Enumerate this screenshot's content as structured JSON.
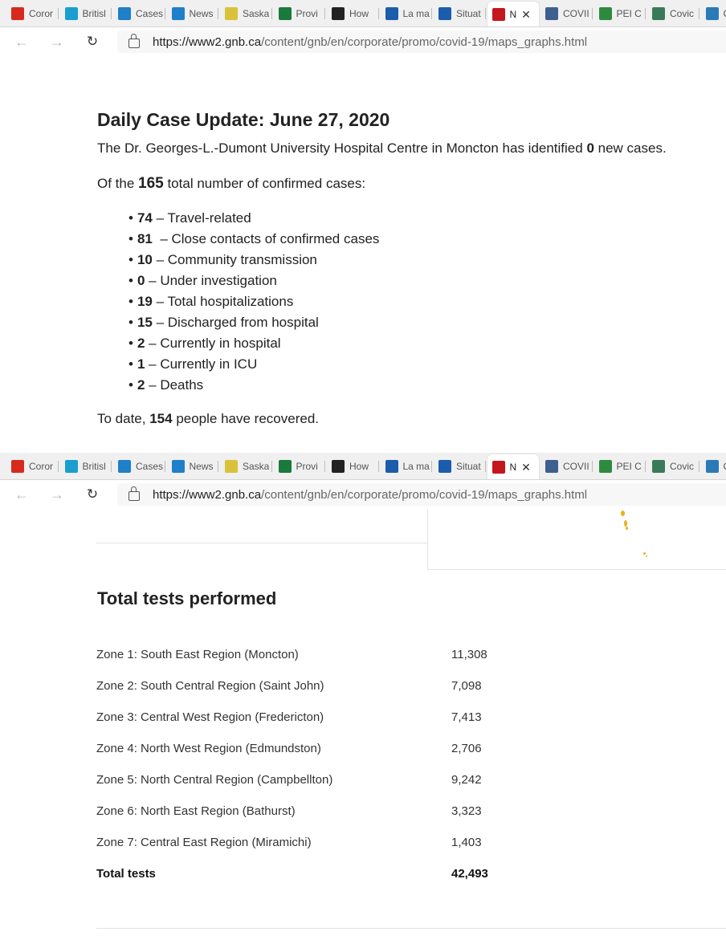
{
  "browser": {
    "tabs": [
      {
        "label": "Coror",
        "icon": "maple-leaf-icon",
        "color": "#d52b1e"
      },
      {
        "label": "Britisl",
        "icon": "bc-icon",
        "color": "#1a9ecf"
      },
      {
        "label": "Cases",
        "icon": "chart-icon",
        "color": "#1f7fc8"
      },
      {
        "label": "News",
        "icon": "chart-icon",
        "color": "#1f7fc8"
      },
      {
        "label": "Saska",
        "icon": "wheat-icon",
        "color": "#d9c23a"
      },
      {
        "label": "Provi",
        "icon": "manitoba-icon",
        "color": "#1a7a3c"
      },
      {
        "label": "How",
        "icon": "ontario-icon",
        "color": "#222222"
      },
      {
        "label": "La ma",
        "icon": "fleur-de-lis-icon",
        "color": "#1b5dab"
      },
      {
        "label": "Situat",
        "icon": "fleur-de-lis-icon",
        "color": "#1b5dab"
      },
      {
        "label": "N",
        "icon": "nb-icon",
        "color": "#c4161c",
        "active": true
      },
      {
        "label": "COVII",
        "icon": "ns-icon",
        "color": "#3f5f8f"
      },
      {
        "label": "PEI C",
        "icon": "pei-icon",
        "color": "#2e8b3e"
      },
      {
        "label": "Covic",
        "icon": "globe-icon",
        "color": "#3a7a5a"
      },
      {
        "label": "C",
        "icon": "nl-icon",
        "color": "#2a7ab8"
      }
    ],
    "url_host": "https://www2.gnb.ca",
    "url_path": "/content/gnb/en/corporate/promo/covid-19/maps_graphs.html"
  },
  "update": {
    "title": "Daily Case Update: June 27, 2020",
    "hospital_pre": "The Dr. Georges-L.-Dumont University Hospital Centre in Moncton has identified ",
    "hospital_num": "0",
    "hospital_post": " new cases.",
    "total_pre": "Of the ",
    "total_num": "165",
    "total_post": " total number of confirmed cases:",
    "items": [
      {
        "num": "74",
        "text": " – Travel-related"
      },
      {
        "num": "81",
        "text": "  – Close contacts of confirmed cases"
      },
      {
        "num": "10",
        "text": " – Community transmission"
      },
      {
        "num": "0",
        "text": " – Under investigation"
      },
      {
        "num": "19",
        "text": " – Total hospitalizations"
      },
      {
        "num": "15",
        "text": " – Discharged from hospital"
      },
      {
        "num": "2",
        "text": " – Currently in hospital"
      },
      {
        "num": "1",
        "text": " – Currently in ICU"
      },
      {
        "num": "2",
        "text": " – Deaths"
      }
    ],
    "recovered_pre": "To date, ",
    "recovered_num": "154",
    "recovered_post": " people have recovered."
  },
  "tests": {
    "title": "Total tests performed",
    "rows": [
      {
        "zone": "Zone 1: South East Region (Moncton)",
        "value": "11,308"
      },
      {
        "zone": "Zone 2: South Central Region (Saint John)",
        "value": "7,098"
      },
      {
        "zone": "Zone 3: Central West Region (Fredericton)",
        "value": "7,413"
      },
      {
        "zone": "Zone 4: North West Region (Edmundston)",
        "value": "2,706"
      },
      {
        "zone": "Zone 5: North Central Region (Campbellton)",
        "value": "9,242"
      },
      {
        "zone": "Zone 6: North East Region (Bathurst)",
        "value": "3,323"
      },
      {
        "zone": "Zone 7: Central East Region (Miramichi)",
        "value": "1,403"
      }
    ],
    "total_label": "Total tests",
    "total_value": "42,493"
  }
}
